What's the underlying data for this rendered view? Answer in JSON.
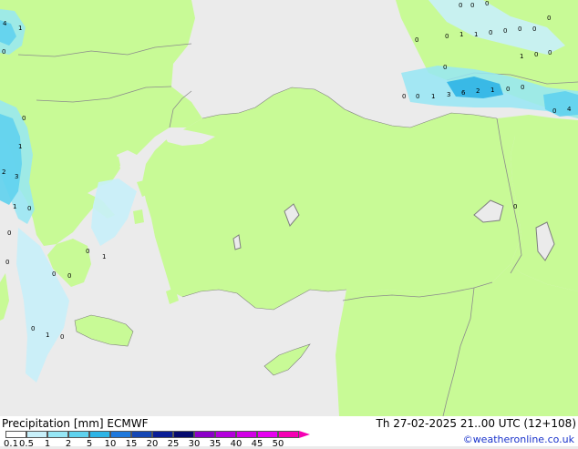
{
  "header": {
    "title": "Precipitation [mm]",
    "model": "ECMWF",
    "valid_time": "Th 27-02-2025 21..00 UTC (12+108)",
    "credit": "©weatheronline.co.uk"
  },
  "legend": {
    "ticks": [
      "0.1",
      "0.5",
      "1",
      "2",
      "5",
      "10",
      "15",
      "20",
      "25",
      "30",
      "35",
      "40",
      "45",
      "50"
    ],
    "colors": [
      "#ffffff",
      "#c8f0fa",
      "#96e6f5",
      "#5fd2ee",
      "#2db4e6",
      "#1e78dc",
      "#1446b4",
      "#0a1e96",
      "#050a6e",
      "#8c00c8",
      "#b400dc",
      "#d200e6",
      "#e600f0",
      "#f500b4"
    ],
    "arrow_color": "#f500b4"
  },
  "map_colors": {
    "sea": "#ebebeb",
    "land": "#c8fa96",
    "coast": "#7f7f7f",
    "border": "#8c8c8c"
  },
  "point_labels": [
    "0",
    "0",
    "0",
    "0",
    "1",
    "0",
    "1",
    "0",
    "0",
    "0",
    "0",
    "1",
    "0",
    "0",
    "0",
    "0",
    "1",
    "3",
    "6",
    "2",
    "1",
    "0",
    "0",
    "0",
    "4",
    "4",
    "1",
    "0",
    "0",
    "1",
    "2",
    "3",
    "1",
    "0",
    "0",
    "0",
    "0",
    "1",
    "0",
    "0",
    "0",
    "1",
    "0",
    "0",
    "0",
    "0"
  ]
}
